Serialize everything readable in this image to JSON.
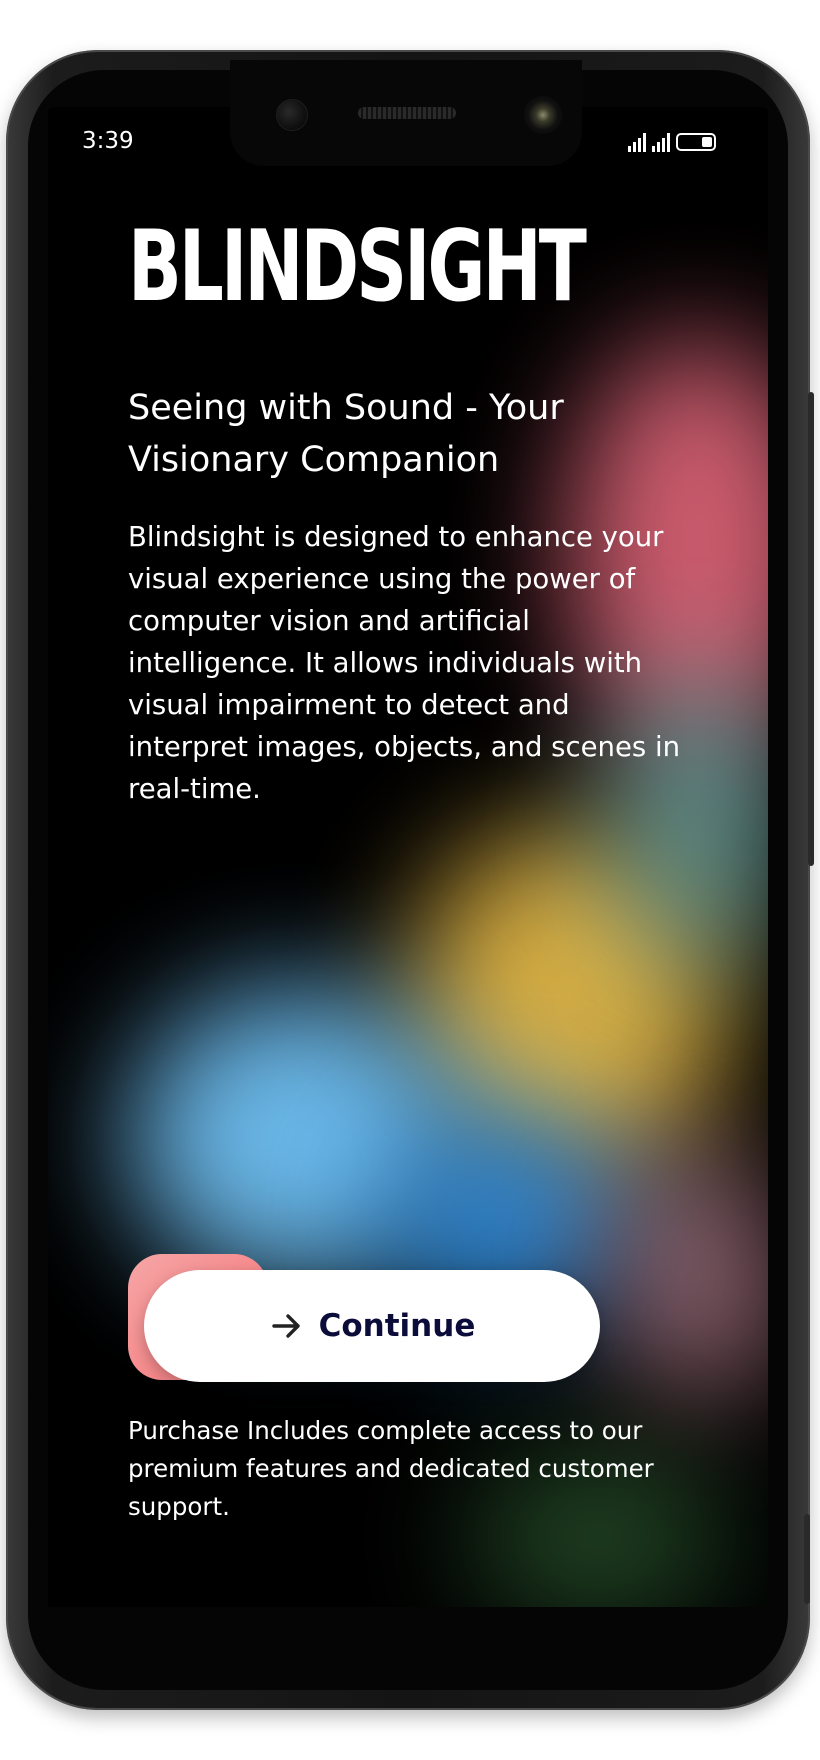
{
  "status_bar": {
    "time": "3:39"
  },
  "app": {
    "title": "BLINDSIGHT",
    "subtitle": "Seeing with Sound - Your Visionary Companion",
    "description": "Blindsight is designed to enhance your visual experience using the power of computer vision and artificial intelligence. It allows individuals with visual impairment to detect and interpret images, objects, and scenes in real-time.",
    "continue_label": "Continue",
    "footnote": "Purchase Includes complete access to our premium features and dedicated customer support."
  },
  "icons": {
    "continue_icon": "arrow-right-icon"
  },
  "colors": {
    "background": "#000000",
    "button_bg": "#ffffff",
    "button_text": "#0c0c3a",
    "accent": "#f7888a"
  }
}
